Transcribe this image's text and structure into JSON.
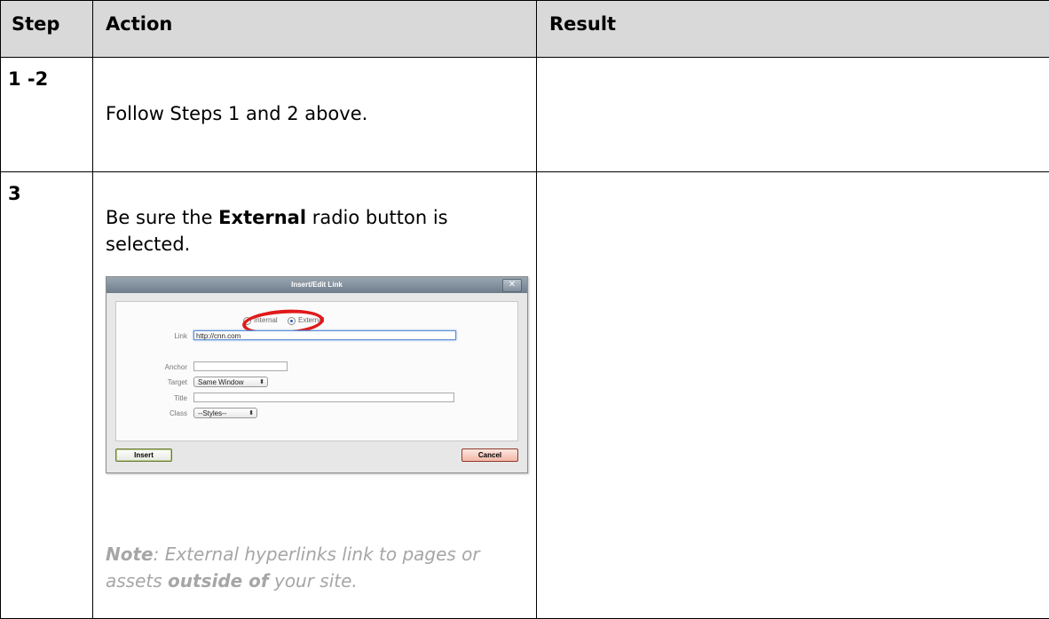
{
  "table": {
    "headers": {
      "step": "Step",
      "action": "Action",
      "result": "Result"
    },
    "rows": [
      {
        "step": "1 -2",
        "action": "Follow Steps 1 and 2 above.",
        "result": ""
      },
      {
        "step": "3",
        "action_prefix": "Be sure the ",
        "action_bold": "External",
        "action_suffix": " radio button is selected.",
        "note_label": "Note",
        "note_text1": ": External hyperlinks link to pages or assets ",
        "note_bold": "outside of",
        "note_text2": " your site.",
        "result": ""
      }
    ]
  },
  "dialog": {
    "title": "Insert/Edit Link",
    "close_icon": "x-icon",
    "radio_internal": "Internal",
    "radio_external": "External",
    "selected": "External",
    "link_label": "Link",
    "link_value": "http://cnn.com",
    "anchor_label": "Anchor",
    "anchor_value": "",
    "target_label": "Target",
    "target_value": "Same Window",
    "title_label": "Title",
    "title_value": "",
    "class_label": "Class",
    "class_value": "--Styles--",
    "insert_label": "Insert",
    "cancel_label": "Cancel",
    "highlight_color": "#e0191a"
  }
}
